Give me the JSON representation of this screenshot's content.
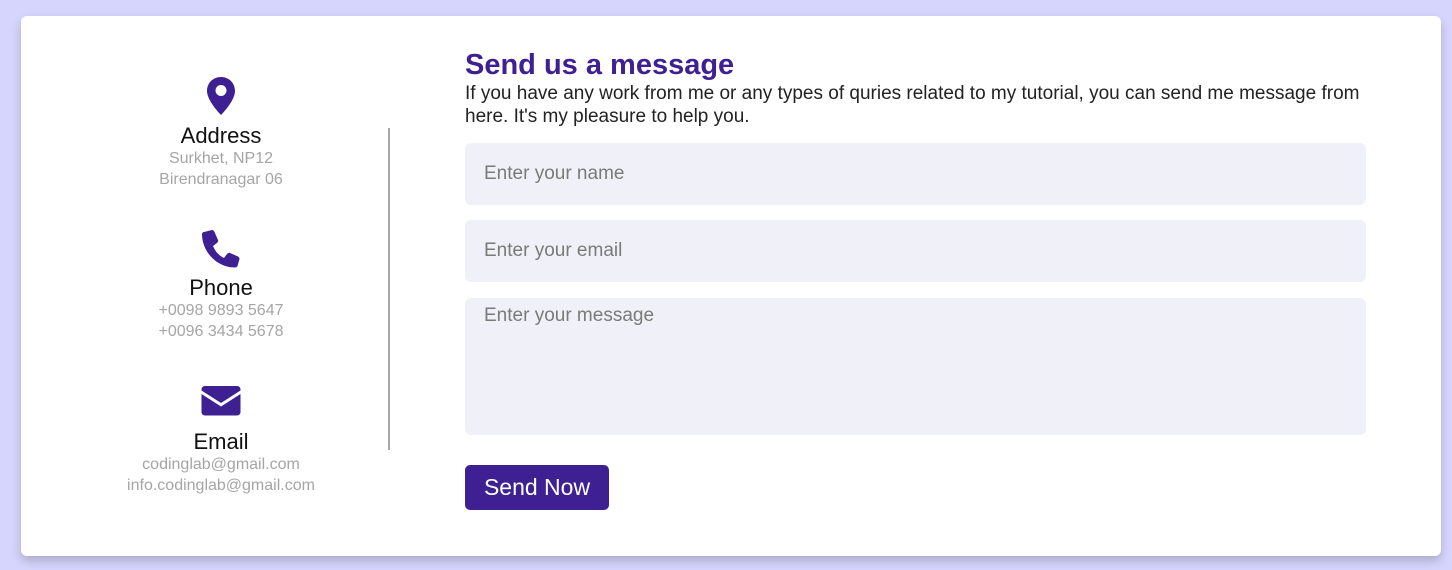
{
  "accent_color": "#3e2093",
  "contact_info": {
    "address": {
      "icon": "map-pin-icon",
      "title": "Address",
      "lines": [
        "Surkhet, NP12",
        "Birendranagar 06"
      ]
    },
    "phone": {
      "icon": "phone-icon",
      "title": "Phone",
      "lines": [
        "+0098 9893 5647",
        "+0096 3434 5678"
      ]
    },
    "email": {
      "icon": "envelope-icon",
      "title": "Email",
      "lines": [
        "codinglab@gmail.com",
        "info.codinglab@gmail.com"
      ]
    }
  },
  "form": {
    "heading": "Send us a message",
    "description": "If you have any work from me or any types of quries related to my tutorial, you can send me message from here. It's my pleasure to help you.",
    "name_placeholder": "Enter your name",
    "email_placeholder": "Enter your email",
    "message_placeholder": "Enter your message",
    "submit_label": "Send Now"
  }
}
